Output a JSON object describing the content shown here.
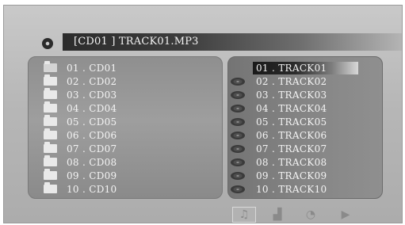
{
  "header": {
    "title": "[CD01 ] TRACK01.MP3",
    "icon": "disc-icon"
  },
  "folders": [
    {
      "label": "01 . CD01",
      "icon": "folder-open-icon"
    },
    {
      "label": "02 . CD02",
      "icon": "folder-icon"
    },
    {
      "label": "03 . CD03",
      "icon": "folder-icon"
    },
    {
      "label": "04 . CD04",
      "icon": "folder-icon"
    },
    {
      "label": "05 . CD05",
      "icon": "folder-icon"
    },
    {
      "label": "06 . CD06",
      "icon": "folder-icon"
    },
    {
      "label": "07 . CD07",
      "icon": "folder-icon"
    },
    {
      "label": "08 . CD08",
      "icon": "folder-icon"
    },
    {
      "label": "09 . CD09",
      "icon": "folder-icon"
    },
    {
      "label": "10 . CD10",
      "icon": "folder-icon"
    }
  ],
  "tracks": [
    {
      "label": "01 .  TRACK01",
      "selected": true
    },
    {
      "label": "02 . TRACK02",
      "selected": false
    },
    {
      "label": "03 . TRACK03",
      "selected": false
    },
    {
      "label": "04 . TRACK04",
      "selected": false
    },
    {
      "label": "05 . TRACK05",
      "selected": false
    },
    {
      "label": "06 . TRACK06",
      "selected": false
    },
    {
      "label": "07 . TRACK07",
      "selected": false
    },
    {
      "label": "08 . TRACK08",
      "selected": false
    },
    {
      "label": "09 . TRACK09",
      "selected": false
    },
    {
      "label": "10 . TRACK10",
      "selected": false
    }
  ],
  "modes": [
    {
      "name": "music-mode-icon",
      "glyph": "♫",
      "active": true
    },
    {
      "name": "photo-mode-icon",
      "glyph": "▟",
      "active": false
    },
    {
      "name": "disc-mode-icon",
      "glyph": "◔",
      "active": false
    },
    {
      "name": "video-mode-icon",
      "glyph": "▶",
      "active": false
    }
  ]
}
